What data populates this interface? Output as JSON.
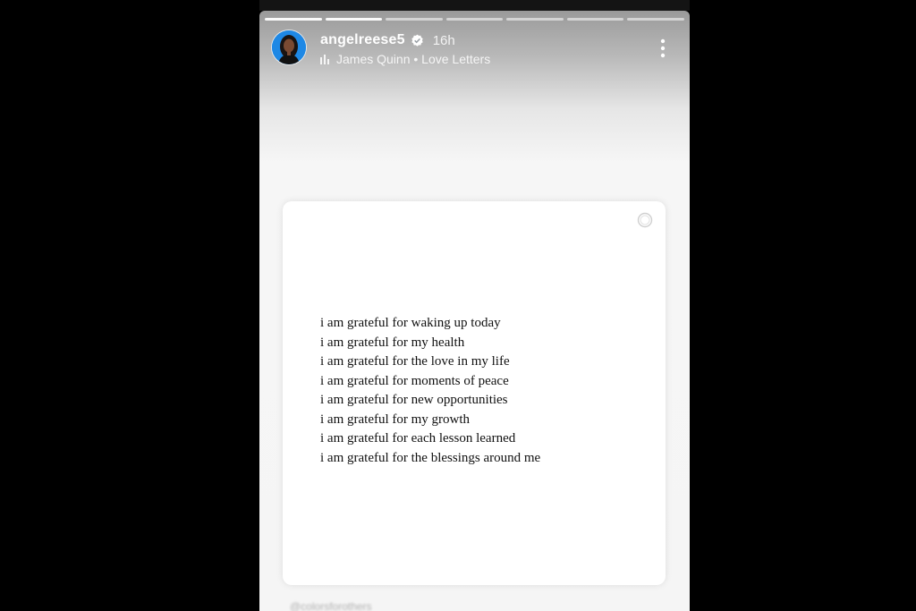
{
  "story": {
    "username": "angelreese5",
    "time_ago": "16h",
    "music": "James Quinn • Love Letters",
    "progress": {
      "segments": 7,
      "completed": 2,
      "current_fraction": 0.0
    },
    "mention": "@colorsforothers"
  },
  "quote_card": {
    "lines": [
      "i am grateful for waking up today",
      "i am grateful for my health",
      "i am grateful for the love in my life",
      "i am grateful for moments of peace",
      "i am grateful for new opportunities",
      "i am grateful for my growth",
      "i am grateful for each lesson learned",
      "i am grateful for the blessings around me"
    ]
  },
  "icons": {
    "verified": "verified-badge-icon",
    "music": "music-bars-icon",
    "more": "more-vertical-icon",
    "card": "circle-icon"
  },
  "colors": {
    "background": "#000000",
    "verified": "#ffffff",
    "text": "#111111",
    "avatar_ring": "#1e88e5"
  }
}
